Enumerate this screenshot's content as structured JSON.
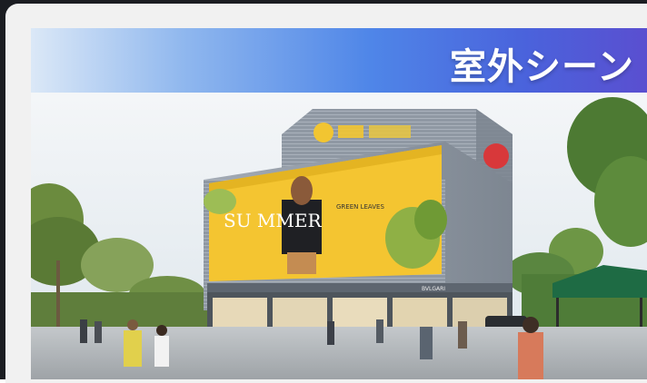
{
  "banner": {
    "title": "室外シーン",
    "gradient": [
      "#dbe8f7",
      "#4f86e8",
      "#5a4fd0"
    ]
  },
  "photo": {
    "subject": "mall-exterior-rendering",
    "billboard": {
      "headline": "SU MMER",
      "side_text": "GREEN LEAVES",
      "background_color": "#f4c531"
    },
    "storefront_sign": "BVLGARI",
    "colors": {
      "sky": "#e8eef3",
      "facade": "#8f98a3",
      "billboard": "#f4c531",
      "tent": "#1e6b44",
      "plaza": "#b3b7ba"
    }
  },
  "frame": {
    "outer_color": "#1b1d22",
    "panel_color": "#f1f1f1"
  }
}
